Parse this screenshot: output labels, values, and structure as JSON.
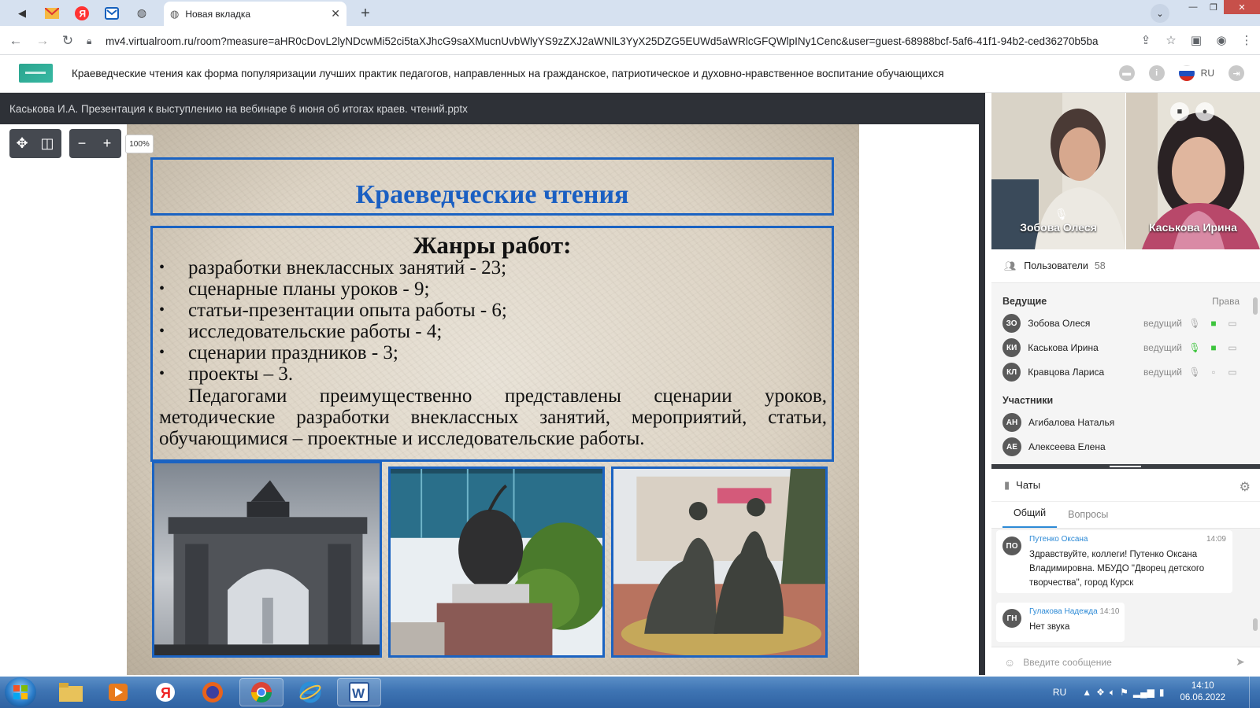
{
  "browser": {
    "active_tab_title": "Новая вкладка",
    "url": "mv4.virtualroom.ru/room?measure=aHR0cDovL2lyNDcwMi52ci5taXJhcG9saXMucnUvbWlyYS9zZXJ2aWNlL3YyX25DZG5EUWd5aWRlcGFQWlpINy1Cenc&user=guest-68988bcf-5af6-41f1-94b2-ced36270b5ba"
  },
  "header": {
    "webinar_title": "Краеведческие чтения как форма популяризации лучших практик педагогов, направленных на гражданское, патриотическое и духовно-нравственное воспитание обучающихся",
    "language": "RU"
  },
  "presentation": {
    "file_title": "Каськова И.А. Презентация к выступлению на вебинаре 6 июня об итогах краев. чтений.pptx",
    "zoom": "100%",
    "slide": {
      "title": "Краеведческие чтения",
      "genres_heading": "Жанры работ:",
      "genres": [
        "разработки внеклассных занятий - 23;",
        "сценарные планы уроков - 9;",
        "статьи-презентации опыта работы - 6;",
        "исследовательские работы - 4;",
        "сценарии праздников - 3;",
        "проекты – 3."
      ],
      "paragraph": "Педагогами преимущественно представлены сценарии уроков, методические разработки внеклассных занятий, мероприятий, статьи, обучающимися – проектные и исследовательские работы."
    }
  },
  "videos": [
    {
      "name": "Зобова Олеся"
    },
    {
      "name": "Каськова Ирина"
    }
  ],
  "users": {
    "title": "Пользователи",
    "count": "58",
    "hosts_label": "Ведущие",
    "rights_label": "Права",
    "participants_label": "Участники",
    "hosts": [
      {
        "initials": "ЗО",
        "name": "Зобова Олеся",
        "role": "ведущий"
      },
      {
        "initials": "КИ",
        "name": "Каськова Ирина",
        "role": "ведущий"
      },
      {
        "initials": "КЛ",
        "name": "Кравцова Лариса",
        "role": "ведущий"
      }
    ],
    "participants": [
      {
        "initials": "АН",
        "name": "Агибалова Наталья"
      },
      {
        "initials": "АЕ",
        "name": "Алексеева Елена"
      }
    ]
  },
  "chat": {
    "title": "Чаты",
    "tabs": [
      "Общий",
      "Вопросы"
    ],
    "messages": [
      {
        "initials": "ПО",
        "author": "Путенко Оксана",
        "time": "14:09",
        "text": "Здравствуйте, коллеги! Путенко Оксана Владимировна. МБУДО \"Дворец детского творчества\", город Курск"
      },
      {
        "initials": "ГН",
        "author": "Гулакова Надежда",
        "time": "14:10",
        "text": "Нет звука"
      }
    ],
    "input_placeholder": "Введите сообщение"
  },
  "taskbar": {
    "language": "RU",
    "time": "14:10",
    "date": "06.06.2022"
  },
  "colors": {
    "slide_accent": "#1b63c2",
    "chat_author": "#2d8ad6",
    "video_on": "#3cc43c",
    "mic_on": "#3cc43c"
  }
}
